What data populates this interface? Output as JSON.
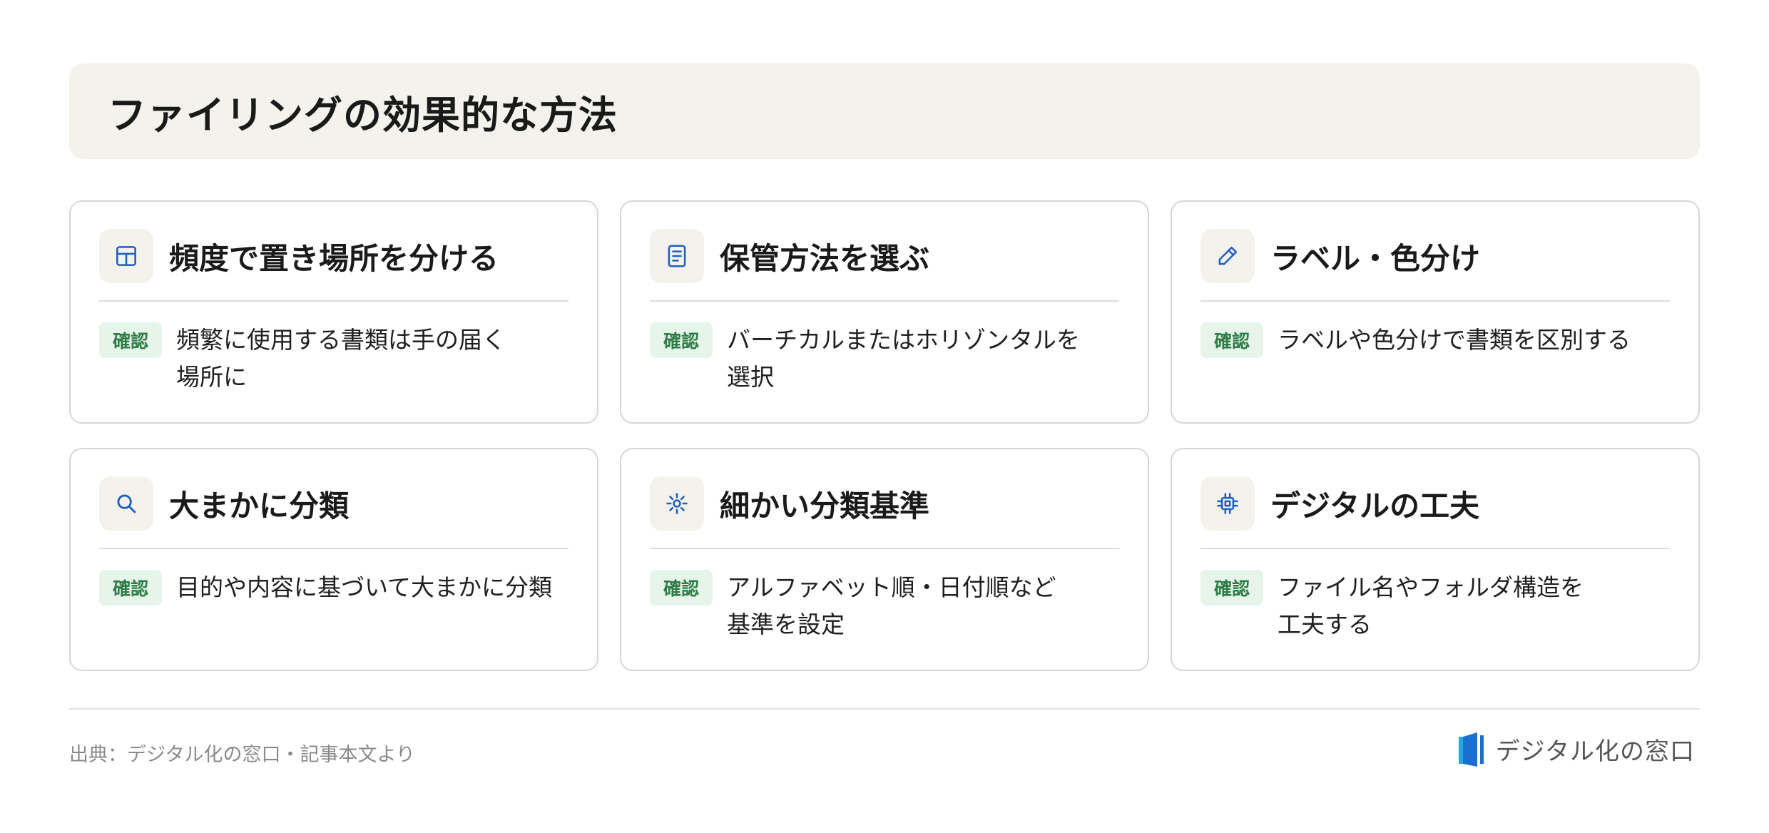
{
  "title": "ファイリングの効果的な方法",
  "badge_label": "確認",
  "colors": {
    "icon_blue": "#1f5fbf",
    "badge_bg": "#e6f4ea",
    "badge_text": "#2e7d46",
    "title_bg": "#f4f2ec"
  },
  "cards": [
    {
      "icon": "grid-table-icon",
      "title": "頻度で置き場所を分ける",
      "line1": "頻繁に使用する書類は手の届く",
      "line2": "場所に"
    },
    {
      "icon": "document-icon",
      "title": "保管方法を選ぶ",
      "line1": "バーチカルまたはホリゾンタルを",
      "line2": "選択"
    },
    {
      "icon": "pencil-icon",
      "title": "ラベル・色分け",
      "line1": "ラベルや色分けで書類を区別する",
      "line2": ""
    },
    {
      "icon": "search-icon",
      "title": "大まかに分類",
      "line1": "目的や内容に基づいて大まかに分類",
      "line2": ""
    },
    {
      "icon": "sun-gear-icon",
      "title": "細かい分類基準",
      "line1": "アルファベット順・日付順など",
      "line2": "基準を設定"
    },
    {
      "icon": "chip-icon",
      "title": "デジタルの工夫",
      "line1": "ファイル名やフォルダ構造を",
      "line2": "工夫する"
    }
  ],
  "footer": {
    "source": "出典：デジタル化の窓口・記事本文より",
    "brand": "デジタル化の窓口"
  }
}
